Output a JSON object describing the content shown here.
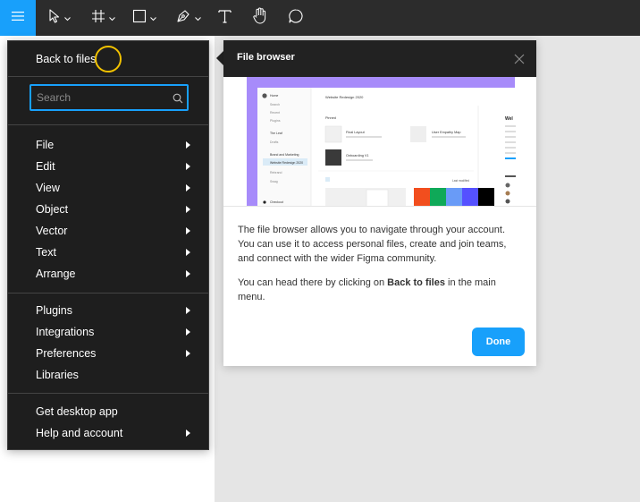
{
  "toolbar": {
    "tools": [
      {
        "name": "move-tool",
        "icon": "cursor-arrow-icon",
        "has_dropdown": true
      },
      {
        "name": "frame-tool",
        "icon": "hash-frame-icon",
        "has_dropdown": true
      },
      {
        "name": "shape-tool",
        "icon": "rectangle-icon",
        "has_dropdown": true
      },
      {
        "name": "pen-tool",
        "icon": "pen-icon",
        "has_dropdown": true
      },
      {
        "name": "text-tool",
        "icon": "text-T-icon",
        "has_dropdown": false
      },
      {
        "name": "hand-tool",
        "icon": "hand-icon",
        "has_dropdown": false
      },
      {
        "name": "comment-tool",
        "icon": "speech-bubble-icon",
        "has_dropdown": false
      }
    ],
    "accent_color": "#18a0fb"
  },
  "menu": {
    "back_label": "Back to files",
    "search_placeholder": "Search",
    "items": [
      {
        "label": "File",
        "submenu": true
      },
      {
        "label": "Edit",
        "submenu": true
      },
      {
        "label": "View",
        "submenu": true
      },
      {
        "label": "Object",
        "submenu": true
      },
      {
        "label": "Vector",
        "submenu": true
      },
      {
        "label": "Text",
        "submenu": true
      },
      {
        "label": "Arrange",
        "submenu": true
      },
      {
        "label": "Plugins",
        "submenu": true
      },
      {
        "label": "Integrations",
        "submenu": true
      },
      {
        "label": "Preferences",
        "submenu": true
      },
      {
        "label": "Libraries",
        "submenu": false
      },
      {
        "label": "Get desktop app",
        "submenu": false
      },
      {
        "label": "Help and account",
        "submenu": true
      }
    ]
  },
  "popover": {
    "title": "File browser",
    "body_1": "The file browser allows you to navigate through your account. You can use it to access personal files, create and join teams, and connect with the wider Figma community.",
    "body_2_pre": "You can head there by clicking on ",
    "body_2_bold": "Back to files",
    "body_2_post": " in the main menu.",
    "done_label": "Done",
    "preview": {
      "sidebar": [
        "Home",
        "Search",
        "Recent",
        "Plugins",
        "The Leaf",
        "Drafts",
        "Brand and Marketing",
        "Website Redesign 2020",
        "Rebrand",
        "Swag",
        "Checkout"
      ],
      "header": "Website Redesign 2020",
      "section": "Pinned",
      "files": [
        "Final Layout",
        "User Empathy Map",
        "Onboarding V1"
      ],
      "sort_label": "Last modified",
      "right_title": "Wel",
      "swatches": [
        "#f24e1e",
        "#0fa958",
        "#699bf7",
        "#5551ff",
        "#000000"
      ]
    }
  }
}
